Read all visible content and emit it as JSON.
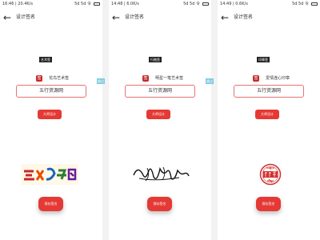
{
  "screens": [
    {
      "status_time": "16:46 | 20.4K/s",
      "status_net": "5d 5d 令",
      "title": "设计签名",
      "label_tag": "艺术签",
      "seal": "签",
      "logo_text": "花鸟艺术签",
      "input_value": "五行资源网",
      "design_label": "大师设计",
      "save_label": "保存签名"
    },
    {
      "status_time": "14:48 | 6.0K/s",
      "status_net": "5d 5d 令",
      "title": "设计签名",
      "label_tag": "行楷签",
      "seal": "签",
      "logo_text": "明星一笔艺术签",
      "input_value": "五行资源网",
      "design_label": "大师设计",
      "save_label": "保存签名"
    },
    {
      "status_time": "14:49 | 0.6K/s",
      "status_net": "5d 5d 令",
      "title": "设计签名",
      "label_tag": "印章签",
      "seal": "签",
      "logo_text": "爱情连心印章",
      "input_value": "五行资源网",
      "design_label": "大师设计",
      "save_label": "保存签名"
    }
  ],
  "arrow_label": "跳过",
  "colors": {
    "accent": "#e53935",
    "field_border": "#e57373",
    "arrow_tag": "#7ec8e3"
  }
}
